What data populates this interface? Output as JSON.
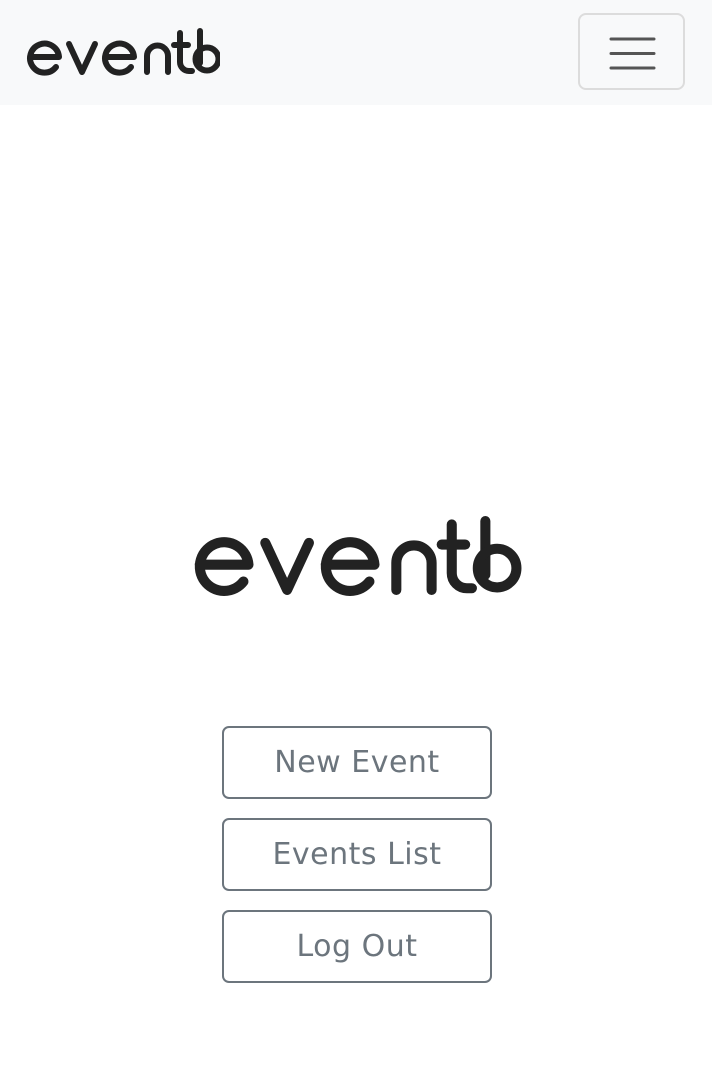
{
  "brand": {
    "name": "eventb",
    "logo_color": "#222222"
  },
  "navbar": {
    "background": "#f8f9fa",
    "toggler_icon": "hamburger-menu-icon"
  },
  "actions": {
    "new_event_label": "New Event",
    "events_list_label": "Events List",
    "log_out_label": "Log Out",
    "button_color": "#6c757d"
  }
}
